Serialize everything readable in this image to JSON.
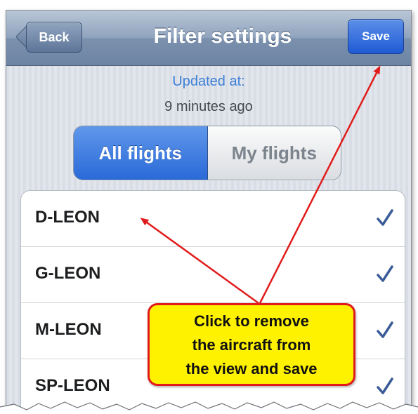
{
  "navbar": {
    "back_label": "Back",
    "title": "Filter settings",
    "save_label": "Save"
  },
  "status": {
    "updated_label": "Updated at:",
    "updated_value": "9 minutes ago"
  },
  "segmented_control": {
    "options": [
      "All flights",
      "My flights"
    ],
    "selected": "All flights"
  },
  "aircraft_list": [
    {
      "label": "D-LEON",
      "checked": true
    },
    {
      "label": "G-LEON",
      "checked": true
    },
    {
      "label": "M-LEON",
      "checked": true
    },
    {
      "label": "SP-LEON",
      "checked": true
    }
  ],
  "callout": {
    "lines": [
      "Click to remove",
      "the aircraft from",
      "the view and save"
    ]
  },
  "colors": {
    "accent_blue": "#2a6ad8",
    "check_color": "#3a5b96",
    "callout_fill": "#fff200",
    "callout_border": "#e11b1b",
    "arrow_color": "#e11b1b"
  },
  "icons": {
    "back": "chevron-left-icon",
    "row_check": "checkmark-icon"
  }
}
